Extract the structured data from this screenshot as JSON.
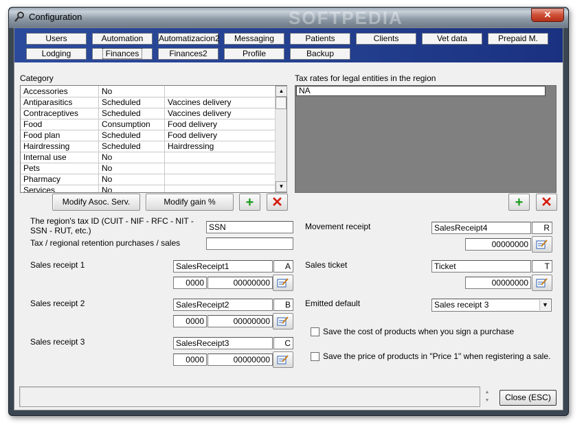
{
  "window": {
    "title": "Configuration",
    "watermark": "SOFTPEDIA",
    "close_glyph": "✕"
  },
  "tabs_row1": [
    "Users",
    "Automation",
    "Automatizacion2",
    "Messaging",
    "Patients",
    "Clients",
    "Vet data",
    "Prepaid M."
  ],
  "tabs_row2": [
    "Lodging",
    "Finances",
    "Finances2",
    "Profile",
    "Backup"
  ],
  "active_tab": "Finances",
  "category": {
    "label": "Category",
    "rows": [
      [
        "Accessories",
        "No",
        ""
      ],
      [
        "Antiparasitics",
        "Scheduled",
        "Vaccines delivery"
      ],
      [
        "Contraceptives",
        "Scheduled",
        "Vaccines delivery"
      ],
      [
        "Food",
        "Consumption",
        "Food delivery"
      ],
      [
        "Food plan",
        "Scheduled",
        "Food delivery"
      ],
      [
        "Hairdressing",
        "Scheduled",
        "Hairdressing"
      ],
      [
        "Internal use",
        "No",
        ""
      ],
      [
        "Pets",
        "No",
        ""
      ],
      [
        "Pharmacy",
        "No",
        ""
      ],
      [
        "Services",
        "No",
        ""
      ]
    ],
    "modify_asoc_label": "Modify Asoc. Serv.",
    "modify_gain_label": "Modify gain %"
  },
  "tax_rates": {
    "label": "Tax rates for legal entities in the region",
    "rows": [
      "NA"
    ]
  },
  "form": {
    "tax_id_label": "The region's tax ID (CUIT - NIF - RFC - NIT - SSN - RUT, etc.)",
    "tax_id_value": "SSN",
    "retention_label": "Tax / regional retention purchases / sales",
    "retention_value": "",
    "sales1": {
      "label": "Sales receipt 1",
      "name": "SalesReceipt1",
      "letter": "A",
      "prefix": "0000",
      "number": "00000000"
    },
    "sales2": {
      "label": "Sales receipt 2",
      "name": "SalesReceipt2",
      "letter": "B",
      "prefix": "0000",
      "number": "00000000"
    },
    "sales3": {
      "label": "Sales receipt 3",
      "name": "SalesReceipt3",
      "letter": "C",
      "prefix": "0000",
      "number": "00000000"
    },
    "movement": {
      "label": "Movement receipt",
      "name": "SalesReceipt4",
      "letter": "R",
      "number": "00000000"
    },
    "ticket": {
      "label": "Sales ticket",
      "name": "Ticket",
      "letter": "T",
      "number": "00000000"
    },
    "emitted_default_label": "Emitted default",
    "emitted_default_value": "Sales receipt 3",
    "save_cost_label": "Save the cost of products when you sign a purchase",
    "save_price_label": "Save the price of products in \"Price 1\" when registering a sale."
  },
  "footer": {
    "close_label": "Close (ESC)"
  },
  "icons": {
    "plus": "+",
    "delete": "✕",
    "scroll_up": "▲",
    "scroll_down": "▼",
    "dropdown": "▼"
  }
}
